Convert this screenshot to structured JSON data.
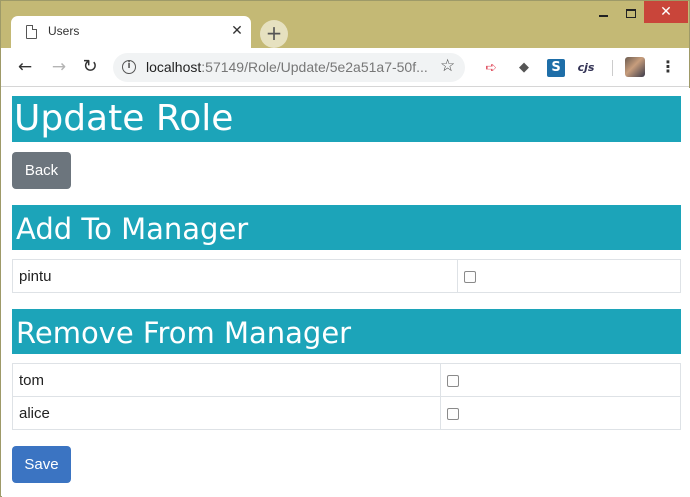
{
  "browser": {
    "tab_title": "Users",
    "tab_close": "✕",
    "new_tab": "+",
    "url_host": "localhost",
    "url_path": ":57149/Role/Update/5e2a51a7-50f...",
    "icons": [
      "file-icon",
      "close-icon",
      "plus-icon",
      "back-arrow-icon",
      "forward-arrow-icon",
      "reload-icon",
      "info-icon",
      "star-icon",
      "extension-icon",
      "menu-dots-icon"
    ],
    "ext_cjs": "cjs",
    "ext_s": "S",
    "window_close": "✕"
  },
  "page": {
    "title": "Update Role",
    "back_label": "Back",
    "add_section_title": "Add To Manager",
    "add_users": [
      {
        "name": "pintu",
        "checked": false
      }
    ],
    "remove_section_title": "Remove From Manager",
    "remove_users": [
      {
        "name": "tom",
        "checked": false
      },
      {
        "name": "alice",
        "checked": false
      }
    ],
    "save_label": "Save"
  },
  "colors": {
    "banner": "#1ca4b9",
    "back_button": "#6c757d",
    "save_button": "#3b74c2",
    "titlebar": "#c4b975",
    "window_close": "#c9453a"
  }
}
